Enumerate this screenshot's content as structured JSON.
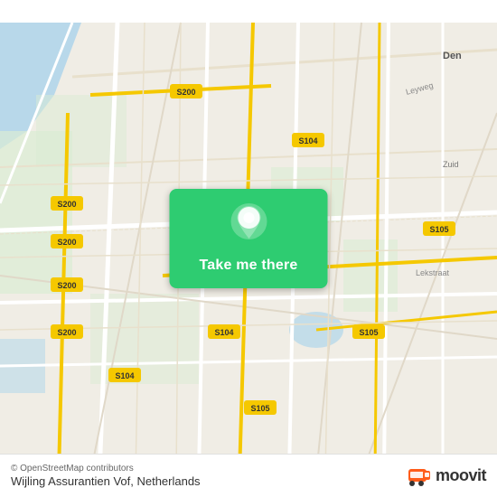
{
  "map": {
    "button_label": "Take me there",
    "location_name": "Wijling Assurantien Vof, Netherlands",
    "osm_credit": "© OpenStreetMap contributors",
    "moovit_text": "moovit",
    "colors": {
      "button_bg": "#2ecc71",
      "road_yellow": "#f5c800",
      "road_white": "#ffffff",
      "map_bg": "#f0ede5",
      "water": "#a8d4e6",
      "green_area": "#c8e6c9"
    },
    "road_labels": [
      "S200",
      "S200",
      "S200",
      "S200",
      "S104",
      "S104",
      "S104",
      "S105",
      "S105",
      "S105"
    ]
  }
}
